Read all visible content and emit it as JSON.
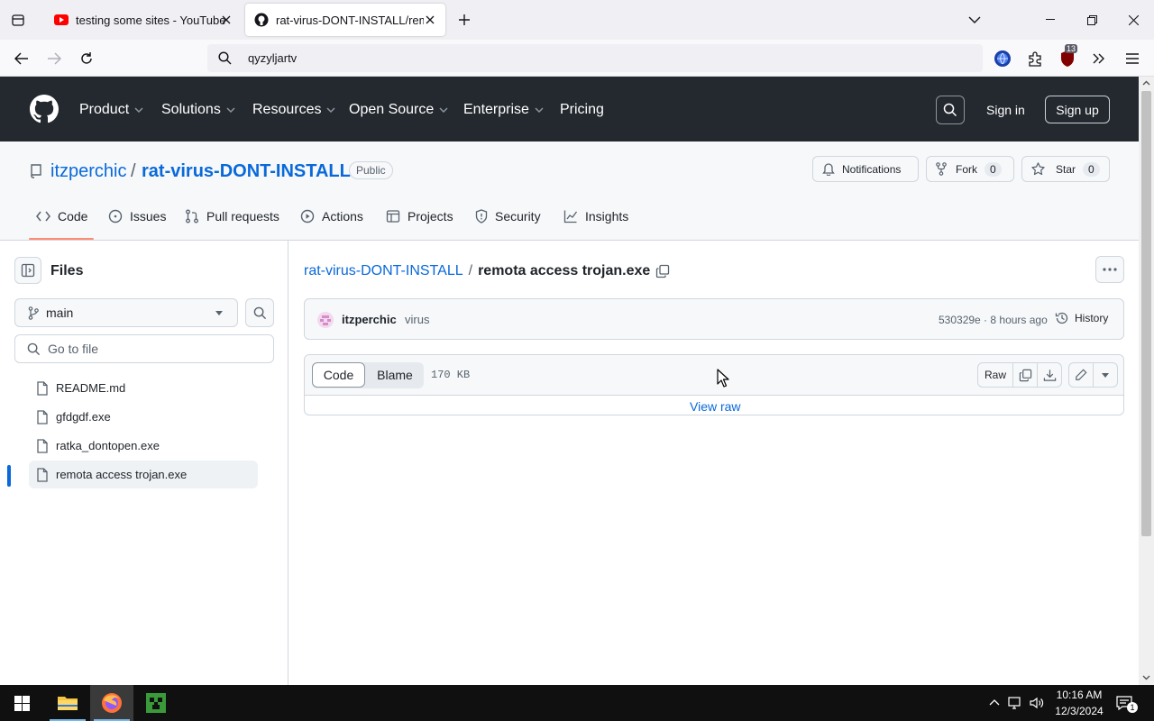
{
  "browser": {
    "tabs": [
      {
        "title": "testing some sites - YouTube"
      },
      {
        "title": "rat-virus-DONT-INSTALL/remota access trojan.exe"
      }
    ],
    "url": "qyzyljartv",
    "extension_badge": "13"
  },
  "github": {
    "nav": [
      "Product",
      "Solutions",
      "Resources",
      "Open Source",
      "Enterprise",
      "Pricing"
    ],
    "sign_in": "Sign in",
    "sign_up": "Sign up"
  },
  "repo": {
    "owner": "itzperchic",
    "separator": "/",
    "name": "rat-virus-DONT-INSTALL",
    "visibility": "Public",
    "notifications_label": "Notifications",
    "fork_label": "Fork",
    "fork_count": "0",
    "star_label": "Star",
    "star_count": "0",
    "tabs": [
      "Code",
      "Issues",
      "Pull requests",
      "Actions",
      "Projects",
      "Security",
      "Insights"
    ]
  },
  "files_panel": {
    "title": "Files",
    "branch": "main",
    "search_placeholder": "Go to file",
    "files": [
      "README.md",
      "gfdgdf.exe",
      "ratka_dontopen.exe",
      "remota access trojan.exe"
    ]
  },
  "file_view": {
    "breadcrumb_repo": "rat-virus-DONT-INSTALL",
    "breadcrumb_sep": "/",
    "file_name": "remota access trojan.exe",
    "commit_author": "itzperchic",
    "commit_message": "virus",
    "commit_meta": "530329e · 8 hours ago",
    "history_label": "History",
    "code_label": "Code",
    "blame_label": "Blame",
    "file_size": "170 KB",
    "raw_label": "Raw",
    "view_raw": "View raw"
  },
  "taskbar": {
    "time": "10:16 AM",
    "date": "12/3/2024",
    "notification_count": "1"
  },
  "colors": {
    "github_header": "#24292f",
    "link_blue": "#0969da",
    "tab_underline": "#fd8c73"
  }
}
